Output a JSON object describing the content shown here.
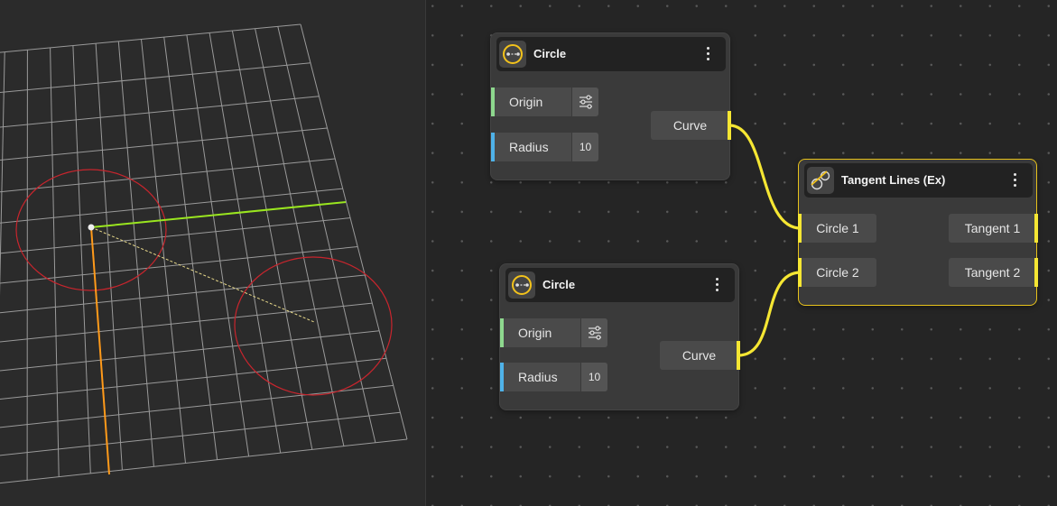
{
  "nodes": {
    "circle1": {
      "title": "Circle",
      "origin_label": "Origin",
      "radius_label": "Radius",
      "radius_value": "10",
      "output_label": "Curve"
    },
    "circle2": {
      "title": "Circle",
      "origin_label": "Origin",
      "radius_label": "Radius",
      "radius_value": "10",
      "output_label": "Curve"
    },
    "tangent": {
      "title": "Tangent Lines (Ex)",
      "inputs": [
        "Circle 1",
        "Circle 2"
      ],
      "outputs": [
        "Tangent 1",
        "Tangent 2"
      ]
    }
  },
  "icons": {
    "circle_node": "circle-with-radius-icon",
    "tangent_node": "tangent-circles-icon",
    "origin_settings": "sliders-icon",
    "node_menu": "kebab-menu-icon"
  },
  "colors": {
    "wire": "#f5e633",
    "selected_border": "#e8c21b",
    "origin_socket": "#8ed88e",
    "radius_socket": "#4fb2e8",
    "axis_x": "#9ae61f",
    "axis_y": "#ff9a1a",
    "circle_preview": "#c8252d"
  }
}
